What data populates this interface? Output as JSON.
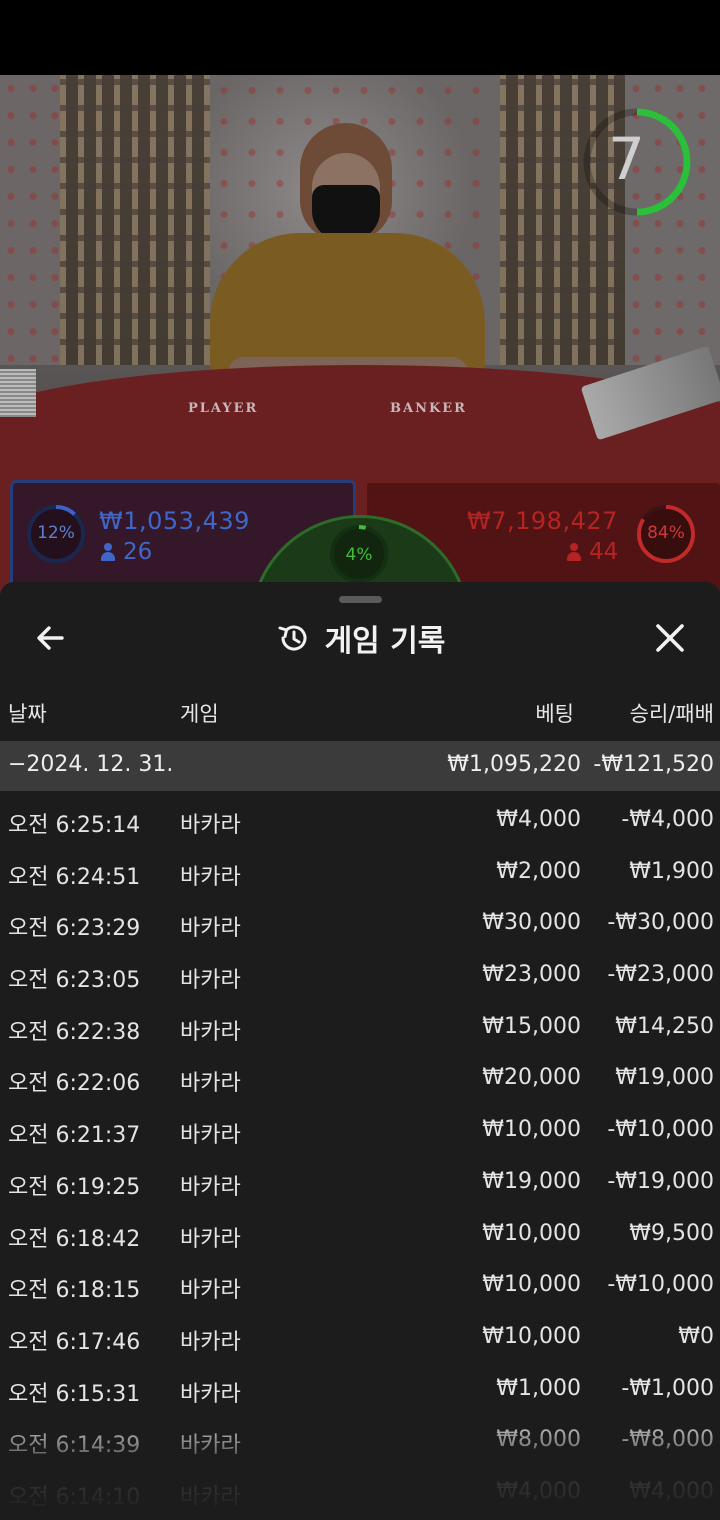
{
  "video": {
    "table_labels": {
      "player": "PLAYER",
      "banker": "BANKER"
    },
    "timer_value": "7",
    "timer_color": "#2bbf3a"
  },
  "bets": {
    "player": {
      "percent": "12%",
      "percent_value": 0.12,
      "amount": "₩1,053,439",
      "players": "26",
      "color": "#3b63c6"
    },
    "tie": {
      "percent": "4%",
      "percent_value": 0.04,
      "color": "#3fbf3a"
    },
    "banker": {
      "percent": "84%",
      "percent_value": 0.84,
      "amount": "₩7,198,427",
      "players": "44",
      "color": "#c22a2a"
    }
  },
  "history": {
    "title": "게임 기록",
    "icons": {
      "back": "arrow-left-icon",
      "history": "history-clock-icon",
      "close": "close-x-icon"
    },
    "columns": {
      "date": "날짜",
      "game": "게임",
      "bet": "베팅",
      "winloss": "승리/패배"
    },
    "date_group": {
      "date": "−2024. 12. 31.",
      "bet": "₩1,095,220",
      "winloss": "-₩121,520"
    },
    "rows": [
      {
        "time": "오전 6:25:14",
        "game": "바카라",
        "bet": "₩4,000",
        "winloss": "-₩4,000"
      },
      {
        "time": "오전 6:24:51",
        "game": "바카라",
        "bet": "₩2,000",
        "winloss": "₩1,900"
      },
      {
        "time": "오전 6:23:29",
        "game": "바카라",
        "bet": "₩30,000",
        "winloss": "-₩30,000"
      },
      {
        "time": "오전 6:23:05",
        "game": "바카라",
        "bet": "₩23,000",
        "winloss": "-₩23,000"
      },
      {
        "time": "오전 6:22:38",
        "game": "바카라",
        "bet": "₩15,000",
        "winloss": "₩14,250"
      },
      {
        "time": "오전 6:22:06",
        "game": "바카라",
        "bet": "₩20,000",
        "winloss": "₩19,000"
      },
      {
        "time": "오전 6:21:37",
        "game": "바카라",
        "bet": "₩10,000",
        "winloss": "-₩10,000"
      },
      {
        "time": "오전 6:19:25",
        "game": "바카라",
        "bet": "₩19,000",
        "winloss": "-₩19,000"
      },
      {
        "time": "오전 6:18:42",
        "game": "바카라",
        "bet": "₩10,000",
        "winloss": "₩9,500"
      },
      {
        "time": "오전 6:18:15",
        "game": "바카라",
        "bet": "₩10,000",
        "winloss": "-₩10,000"
      },
      {
        "time": "오전 6:17:46",
        "game": "바카라",
        "bet": "₩10,000",
        "winloss": "₩0"
      },
      {
        "time": "오전 6:15:31",
        "game": "바카라",
        "bet": "₩1,000",
        "winloss": "-₩1,000"
      },
      {
        "time": "오전 6:14:39",
        "game": "바카라",
        "bet": "₩8,000",
        "winloss": "-₩8,000"
      },
      {
        "time": "오전 6:14:10",
        "game": "바카라",
        "bet": "₩4,000",
        "winloss": "₩4,000"
      }
    ]
  }
}
